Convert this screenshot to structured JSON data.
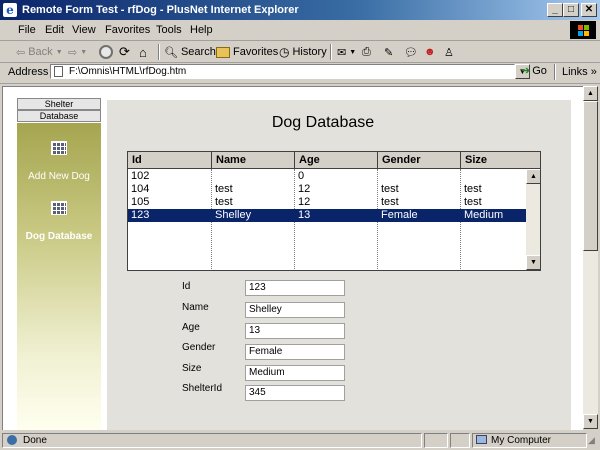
{
  "window": {
    "title": "Remote Form Test - rfDog - PlusNet Internet Explorer",
    "minimize": "_",
    "maximize": "□",
    "close": "✕"
  },
  "menu": [
    "File",
    "Edit",
    "View",
    "Favorites",
    "Tools",
    "Help"
  ],
  "toolbar": {
    "back": "Back",
    "search": "Search",
    "favorites": "Favorites",
    "history": "History"
  },
  "address": {
    "label": "Address",
    "value": "F:\\Omnis\\HTML\\rfDog.htm",
    "go": "Go",
    "links": "Links"
  },
  "nav": {
    "tabs": [
      "Shelter",
      "Database"
    ],
    "items": [
      {
        "label": "Add New Dog",
        "icon": "grid-icon"
      },
      {
        "label": "Dog Database",
        "icon": "grid-icon"
      }
    ]
  },
  "form": {
    "title": "Dog Database",
    "columns": [
      "Id",
      "Name",
      "Age",
      "Gender",
      "Size"
    ],
    "rows": [
      [
        "102",
        "",
        "0",
        "",
        ""
      ],
      [
        "104",
        "test",
        "12",
        "test",
        "test"
      ],
      [
        "105",
        "test",
        "12",
        "test",
        "test"
      ],
      [
        "123",
        "Shelley",
        "13",
        "Female",
        "Medium"
      ]
    ],
    "selected_row": 3,
    "fields": [
      {
        "label": "Id",
        "value": "123"
      },
      {
        "label": "Name",
        "value": "Shelley"
      },
      {
        "label": "Age",
        "value": "13"
      },
      {
        "label": "Gender",
        "value": "Female"
      },
      {
        "label": "Size",
        "value": "Medium"
      },
      {
        "label": "ShelterId",
        "value": "345"
      }
    ]
  },
  "status": {
    "text": "Done",
    "zone": "My Computer"
  },
  "colors": {
    "selection": "#0a246a",
    "titlebar": "#0a246a",
    "panel": "#e3e1dc"
  }
}
